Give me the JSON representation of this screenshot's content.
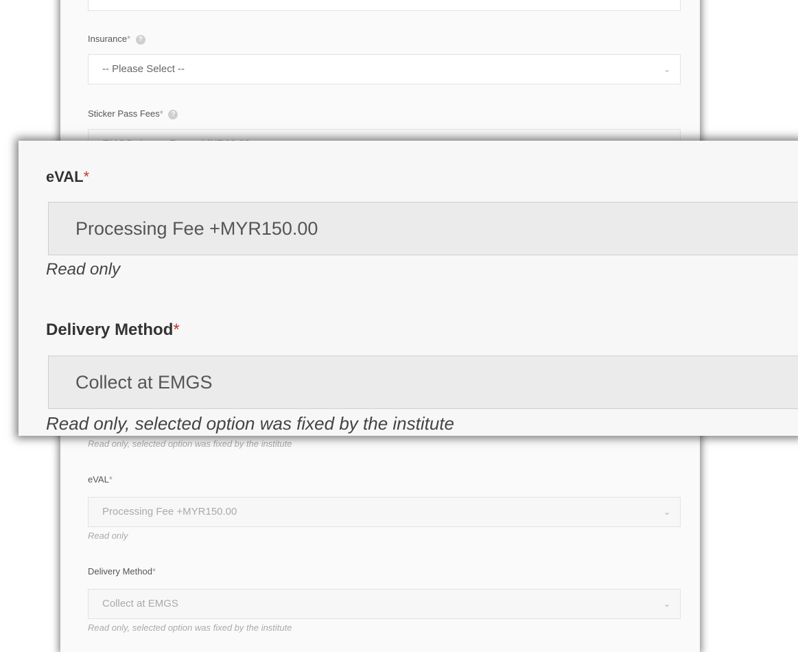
{
  "background_form": {
    "insurance": {
      "label": "Insurance",
      "required_mark": "*",
      "value": "-- Please Select --"
    },
    "sticker_pass_fees": {
      "label": "Sticker Pass Fees",
      "required_mark": "*",
      "value": "EMGS_1 year Pass +MYR60.00"
    },
    "partial_note": "Read only, selected option was fixed by the institute",
    "eval": {
      "label": "eVAL",
      "required_mark": "*",
      "value": "Processing Fee +MYR150.00",
      "note": "Read only"
    },
    "delivery_method": {
      "label": "Delivery Method",
      "required_mark": "*",
      "value": "Collect at EMGS",
      "note": "Read only, selected option was fixed by the institute"
    }
  },
  "zoom_callout": {
    "eval": {
      "label": "eVAL",
      "required_mark": "*",
      "value": "Processing Fee +MYR150.00",
      "note": "Read only"
    },
    "delivery_method": {
      "label": "Delivery Method",
      "required_mark": "*",
      "value": "Collect at EMGS",
      "note": "Read only, selected option was fixed by the institute"
    }
  },
  "icons": {
    "help": "question-circle-icon",
    "dropdown": "chevron-down-icon"
  },
  "colors": {
    "required_zoom": "#c0392b",
    "card_background": "#fafafa"
  }
}
